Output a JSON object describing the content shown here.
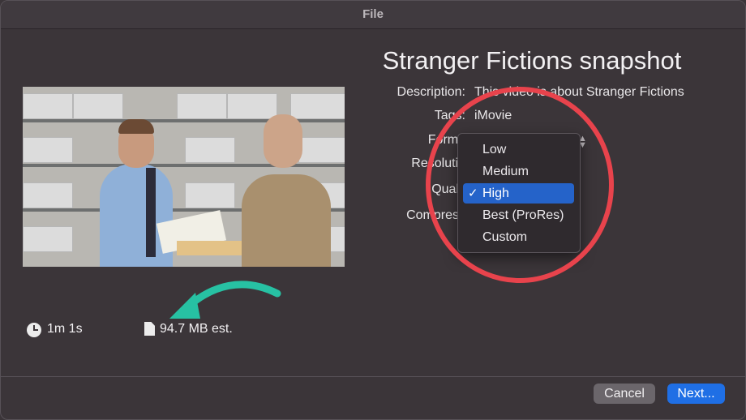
{
  "window": {
    "title": "File"
  },
  "export": {
    "title": "Stranger Fictions snapshot",
    "fields": [
      {
        "label": "Description:",
        "value": "This video is about Stranger Fictions"
      },
      {
        "label": "Tags:",
        "value": "iMovie"
      },
      {
        "label": "Forma",
        "value": ""
      },
      {
        "label": "Resolutio",
        "value": ""
      },
      {
        "label": "Qualit",
        "value": ""
      },
      {
        "label": "Compress",
        "value": ""
      }
    ],
    "duration": "1m 1s",
    "file_size": "94.7 MB est."
  },
  "quality_menu": {
    "options": [
      "Low",
      "Medium",
      "High",
      "Best (ProRes)",
      "Custom"
    ],
    "selected_index": 2,
    "check_glyph": "✓"
  },
  "buttons": {
    "cancel": "Cancel",
    "next": "Next..."
  },
  "annotations": {
    "circle_color": "#e8434c",
    "arrow_color": "#27c1a3"
  },
  "icons": {
    "clock": "clock-icon",
    "document": "document-icon",
    "stepper": "chevron-updown-icon"
  }
}
